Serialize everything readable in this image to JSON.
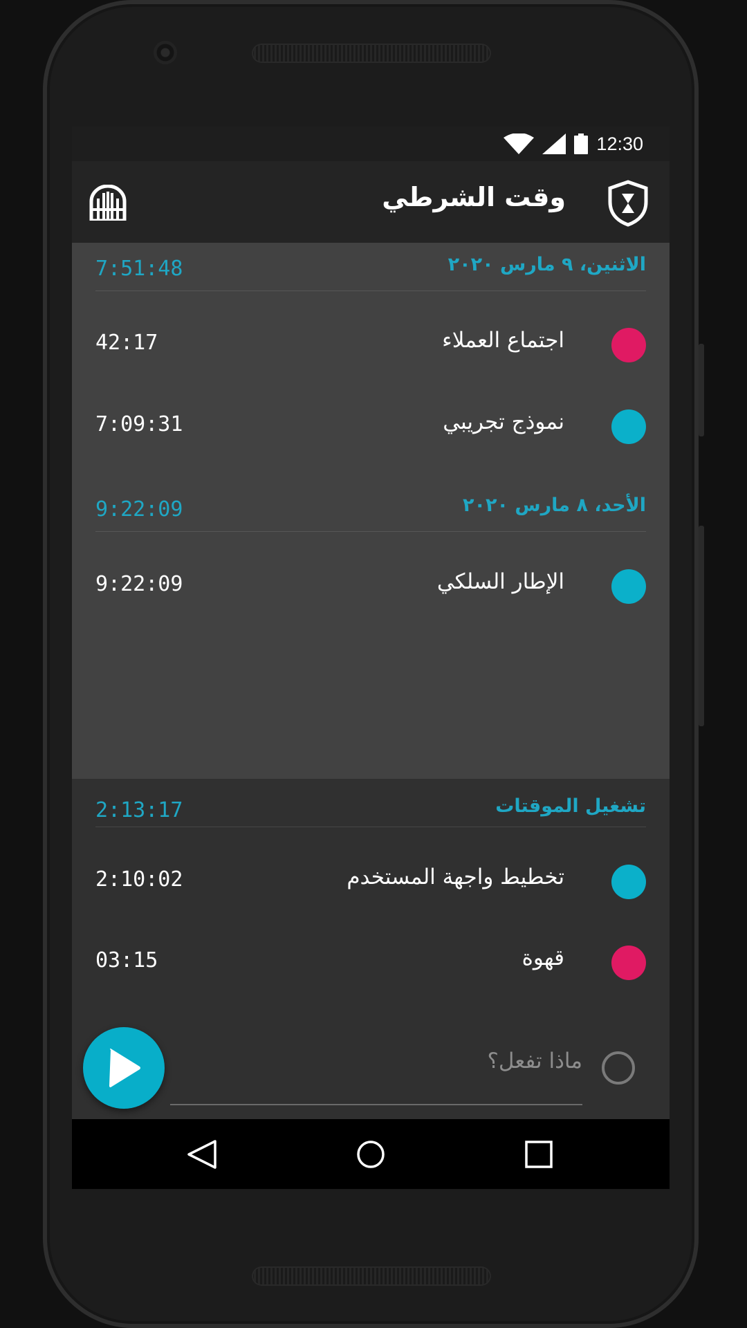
{
  "status": {
    "time": "12:30"
  },
  "app": {
    "title": "وقت الشرطي"
  },
  "days": [
    {
      "date": "الاثنين، ٩ مارس ٢٠٢٠",
      "total": "7:51:48",
      "entries": [
        {
          "name": "اجتماع العملاء",
          "duration": "42:17",
          "color": "#e01a63"
        },
        {
          "name": "نموذج تجريبي",
          "duration": "7:09:31",
          "color": "#0bb0ca"
        }
      ]
    },
    {
      "date": "الأحد، ٨ مارس ٢٠٢٠",
      "total": "9:22:09",
      "entries": [
        {
          "name": "الإطار السلكي",
          "duration": "9:22:09",
          "color": "#0bb0ca"
        }
      ]
    }
  ],
  "running": {
    "label": "تشغيل الموقتات",
    "total": "2:13:17",
    "entries": [
      {
        "name": "تخطيط واجهة المستخدم",
        "duration": "2:10:02",
        "color": "#0bb0ca"
      },
      {
        "name": "قهوة",
        "duration": "03:15",
        "color": "#e01a63"
      }
    ]
  },
  "new_entry": {
    "placeholder": "ماذا تفعل؟"
  },
  "colors": {
    "accent": "#1fa7c4",
    "fab": "#08aec9",
    "pink": "#e01a63",
    "cyan": "#0bb0ca"
  }
}
